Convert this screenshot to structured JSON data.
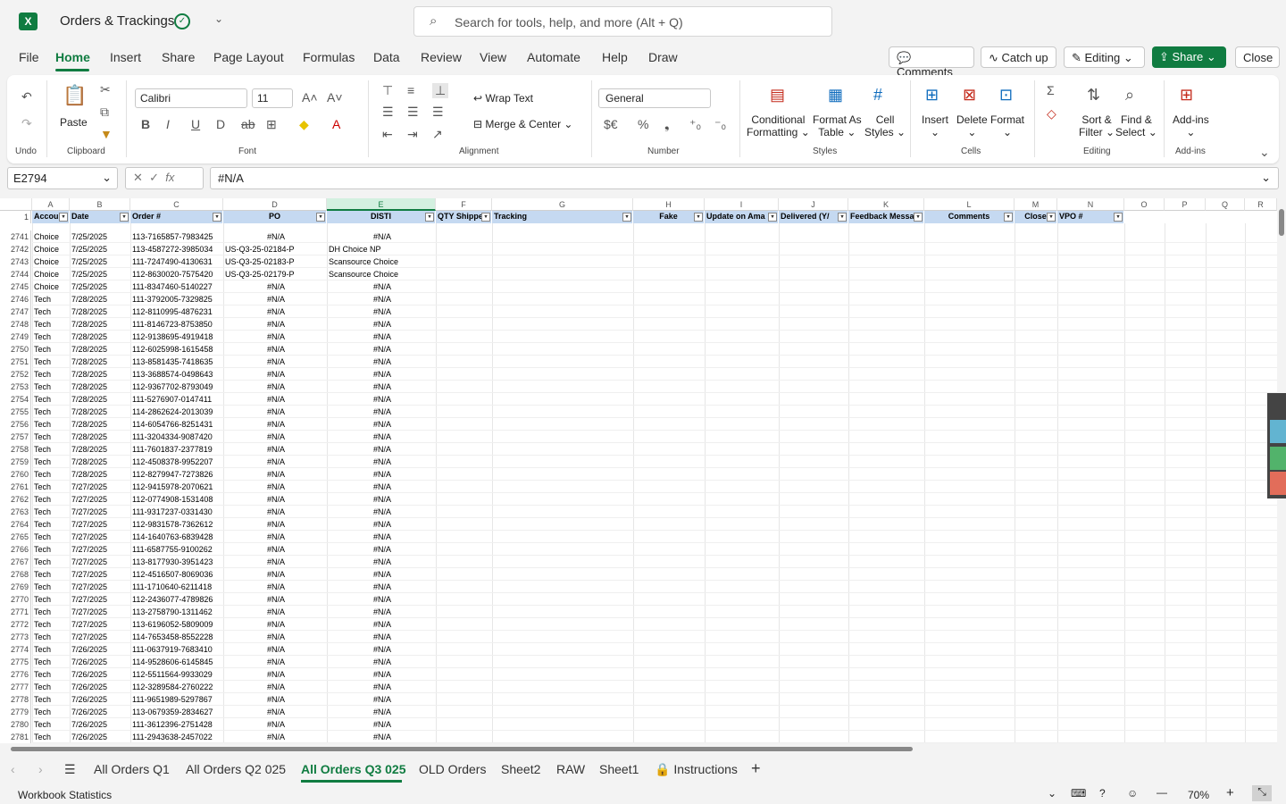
{
  "app": {
    "title": "Orders & Trackings",
    "search_placeholder": "Search for tools, help, and more (Alt + Q)"
  },
  "menu": [
    "File",
    "Home",
    "Insert",
    "Share",
    "Page Layout",
    "Formulas",
    "Data",
    "Review",
    "View",
    "Automate",
    "Help",
    "Draw"
  ],
  "top_buttons": {
    "comments": "Comments",
    "catchup": "Catch up",
    "editing": "Editing",
    "share": "Share",
    "close": "Close"
  },
  "ribbon": {
    "groups": {
      "undo": "Undo",
      "clipboard": "Clipboard",
      "font": "Font",
      "alignment": "Alignment",
      "number": "Number",
      "styles": "Styles",
      "cells": "Cells",
      "editing": "Editing",
      "addins": "Add-ins"
    },
    "paste": "Paste",
    "font_name": "Calibri",
    "font_size": "11",
    "wrap": "Wrap Text",
    "merge": "Merge & Center",
    "number_format": "General",
    "cond1": "Conditional",
    "cond2": "Formatting",
    "fmt1": "Format As",
    "fmt2": "Table",
    "cs1": "Cell",
    "cs2": "Styles",
    "insert": "Insert",
    "delete": "Delete",
    "format": "Format",
    "sort1": "Sort &",
    "sort2": "Filter",
    "find1": "Find &",
    "find2": "Select",
    "addins": "Add-ins"
  },
  "formula_bar": {
    "name_box": "E2794",
    "formula": "#N/A",
    "fx": "fx"
  },
  "columns": [
    "A",
    "B",
    "C",
    "D",
    "E",
    "F",
    "G",
    "H",
    "I",
    "J",
    "K",
    "L",
    "M",
    "N",
    "O",
    "P",
    "Q",
    "R"
  ],
  "headers": [
    "Accou",
    "Date",
    "Order #",
    "PO",
    "DISTI",
    "QTY Shippe",
    "Tracking",
    "Fake",
    "Update on Ama",
    "Delivered (Y/",
    "Feedback Messa",
    "Comments",
    "Close",
    "VPO #"
  ],
  "rows": [
    [
      "2741",
      "Choice",
      "7/25/2025",
      "113-7165857-7983425",
      "#N/A",
      "#N/A"
    ],
    [
      "2742",
      "Choice",
      "7/25/2025",
      "113-4587272-3985034",
      "US-Q3-25-02184-P",
      "DH Choice NP"
    ],
    [
      "2743",
      "Choice",
      "7/25/2025",
      "111-7247490-4130631",
      "US-Q3-25-02183-P",
      "Scansource Choice"
    ],
    [
      "2744",
      "Choice",
      "7/25/2025",
      "112-8630020-7575420",
      "US-Q3-25-02179-P",
      "Scansource Choice"
    ],
    [
      "2745",
      "Choice",
      "7/25/2025",
      "111-8347460-5140227",
      "#N/A",
      "#N/A"
    ],
    [
      "2746",
      "Tech",
      "7/28/2025",
      "111-3792005-7329825",
      "#N/A",
      "#N/A"
    ],
    [
      "2747",
      "Tech",
      "7/28/2025",
      "112-8110995-4876231",
      "#N/A",
      "#N/A"
    ],
    [
      "2748",
      "Tech",
      "7/28/2025",
      "111-8146723-8753850",
      "#N/A",
      "#N/A"
    ],
    [
      "2749",
      "Tech",
      "7/28/2025",
      "112-9138695-4919418",
      "#N/A",
      "#N/A"
    ],
    [
      "2750",
      "Tech",
      "7/28/2025",
      "112-6025998-1615458",
      "#N/A",
      "#N/A"
    ],
    [
      "2751",
      "Tech",
      "7/28/2025",
      "113-8581435-7418635",
      "#N/A",
      "#N/A"
    ],
    [
      "2752",
      "Tech",
      "7/28/2025",
      "113-3688574-0498643",
      "#N/A",
      "#N/A"
    ],
    [
      "2753",
      "Tech",
      "7/28/2025",
      "112-9367702-8793049",
      "#N/A",
      "#N/A"
    ],
    [
      "2754",
      "Tech",
      "7/28/2025",
      "111-5276907-0147411",
      "#N/A",
      "#N/A"
    ],
    [
      "2755",
      "Tech",
      "7/28/2025",
      "114-2862624-2013039",
      "#N/A",
      "#N/A"
    ],
    [
      "2756",
      "Tech",
      "7/28/2025",
      "114-6054766-8251431",
      "#N/A",
      "#N/A"
    ],
    [
      "2757",
      "Tech",
      "7/28/2025",
      "111-3204334-9087420",
      "#N/A",
      "#N/A"
    ],
    [
      "2758",
      "Tech",
      "7/28/2025",
      "111-7601837-2377819",
      "#N/A",
      "#N/A"
    ],
    [
      "2759",
      "Tech",
      "7/28/2025",
      "112-4508378-9952207",
      "#N/A",
      "#N/A"
    ],
    [
      "2760",
      "Tech",
      "7/28/2025",
      "112-8279947-7273826",
      "#N/A",
      "#N/A"
    ],
    [
      "2761",
      "Tech",
      "7/27/2025",
      "112-9415978-2070621",
      "#N/A",
      "#N/A"
    ],
    [
      "2762",
      "Tech",
      "7/27/2025",
      "112-0774908-1531408",
      "#N/A",
      "#N/A"
    ],
    [
      "2763",
      "Tech",
      "7/27/2025",
      "111-9317237-0331430",
      "#N/A",
      "#N/A"
    ],
    [
      "2764",
      "Tech",
      "7/27/2025",
      "112-9831578-7362612",
      "#N/A",
      "#N/A"
    ],
    [
      "2765",
      "Tech",
      "7/27/2025",
      "114-1640763-6839428",
      "#N/A",
      "#N/A"
    ],
    [
      "2766",
      "Tech",
      "7/27/2025",
      "111-6587755-9100262",
      "#N/A",
      "#N/A"
    ],
    [
      "2767",
      "Tech",
      "7/27/2025",
      "113-8177930-3951423",
      "#N/A",
      "#N/A"
    ],
    [
      "2768",
      "Tech",
      "7/27/2025",
      "112-4516507-8069036",
      "#N/A",
      "#N/A"
    ],
    [
      "2769",
      "Tech",
      "7/27/2025",
      "111-1710640-6211418",
      "#N/A",
      "#N/A"
    ],
    [
      "2770",
      "Tech",
      "7/27/2025",
      "112-2436077-4789826",
      "#N/A",
      "#N/A"
    ],
    [
      "2771",
      "Tech",
      "7/27/2025",
      "113-2758790-1311462",
      "#N/A",
      "#N/A"
    ],
    [
      "2772",
      "Tech",
      "7/27/2025",
      "113-6196052-5809009",
      "#N/A",
      "#N/A"
    ],
    [
      "2773",
      "Tech",
      "7/27/2025",
      "114-7653458-8552228",
      "#N/A",
      "#N/A"
    ],
    [
      "2774",
      "Tech",
      "7/26/2025",
      "111-0637919-7683410",
      "#N/A",
      "#N/A"
    ],
    [
      "2775",
      "Tech",
      "7/26/2025",
      "114-9528606-6145845",
      "#N/A",
      "#N/A"
    ],
    [
      "2776",
      "Tech",
      "7/26/2025",
      "112-5511564-9933029",
      "#N/A",
      "#N/A"
    ],
    [
      "2777",
      "Tech",
      "7/26/2025",
      "112-3289584-2760222",
      "#N/A",
      "#N/A"
    ],
    [
      "2778",
      "Tech",
      "7/26/2025",
      "111-9651989-5297867",
      "#N/A",
      "#N/A"
    ],
    [
      "2779",
      "Tech",
      "7/26/2025",
      "113-0679359-2834627",
      "#N/A",
      "#N/A"
    ],
    [
      "2780",
      "Tech",
      "7/26/2025",
      "111-3612396-2751428",
      "#N/A",
      "#N/A"
    ],
    [
      "2781",
      "Tech",
      "7/26/2025",
      "111-2943638-2457022",
      "#N/A",
      "#N/A"
    ]
  ],
  "sheets": [
    "All Orders Q1",
    "All Orders Q2 025",
    "All Orders Q3 025",
    "OLD Orders",
    "Sheet2",
    "RAW",
    "Sheet1",
    "Instructions"
  ],
  "status": {
    "left": "Workbook Statistics",
    "zoom": "70%"
  }
}
